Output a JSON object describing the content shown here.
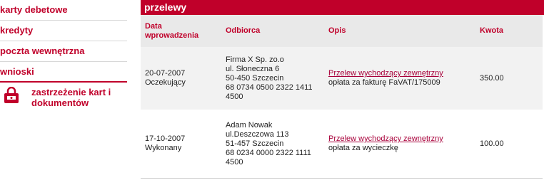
{
  "sidebar": {
    "items": [
      {
        "label": "karty debetowe"
      },
      {
        "label": "kredyty"
      },
      {
        "label": "poczta wewnętrzna"
      },
      {
        "label": "wnioski"
      }
    ],
    "subitem": {
      "label": "zastrzeżenie kart i dokumentów",
      "icon": "lock-icon"
    }
  },
  "main": {
    "section_title": "przelewy",
    "columns": [
      "Data wprowadzenia",
      "Odbiorca",
      "Opis",
      "Kwota"
    ],
    "rows": [
      {
        "date": "20-07-2007",
        "status": "Oczekujący",
        "recipient": [
          "Firma X Sp. zo.o",
          "ul. Słoneczna 6",
          "50-450 Szczecin",
          "68 0734 0500 2322 1411",
          "4500"
        ],
        "description_link": "Przelew wychodzący zewnętrzny",
        "description_note": "opłata za fakturę FaVAT/175009",
        "amount": "350.00"
      },
      {
        "date": "17-10-2007",
        "status": "Wykonany",
        "recipient": [
          "Adam Nowak",
          "ul.Deszczowa 113",
          "51-457 Szczecin",
          "68 0234 0000 2322 1111",
          "4500"
        ],
        "description_link": "Przelew wychodzący zewnętrzny",
        "description_note": "opłata za wycieczkę",
        "amount": "100.00"
      }
    ]
  },
  "colors": {
    "accent": "#c0002a",
    "header_bg": "#e9e9e9"
  }
}
